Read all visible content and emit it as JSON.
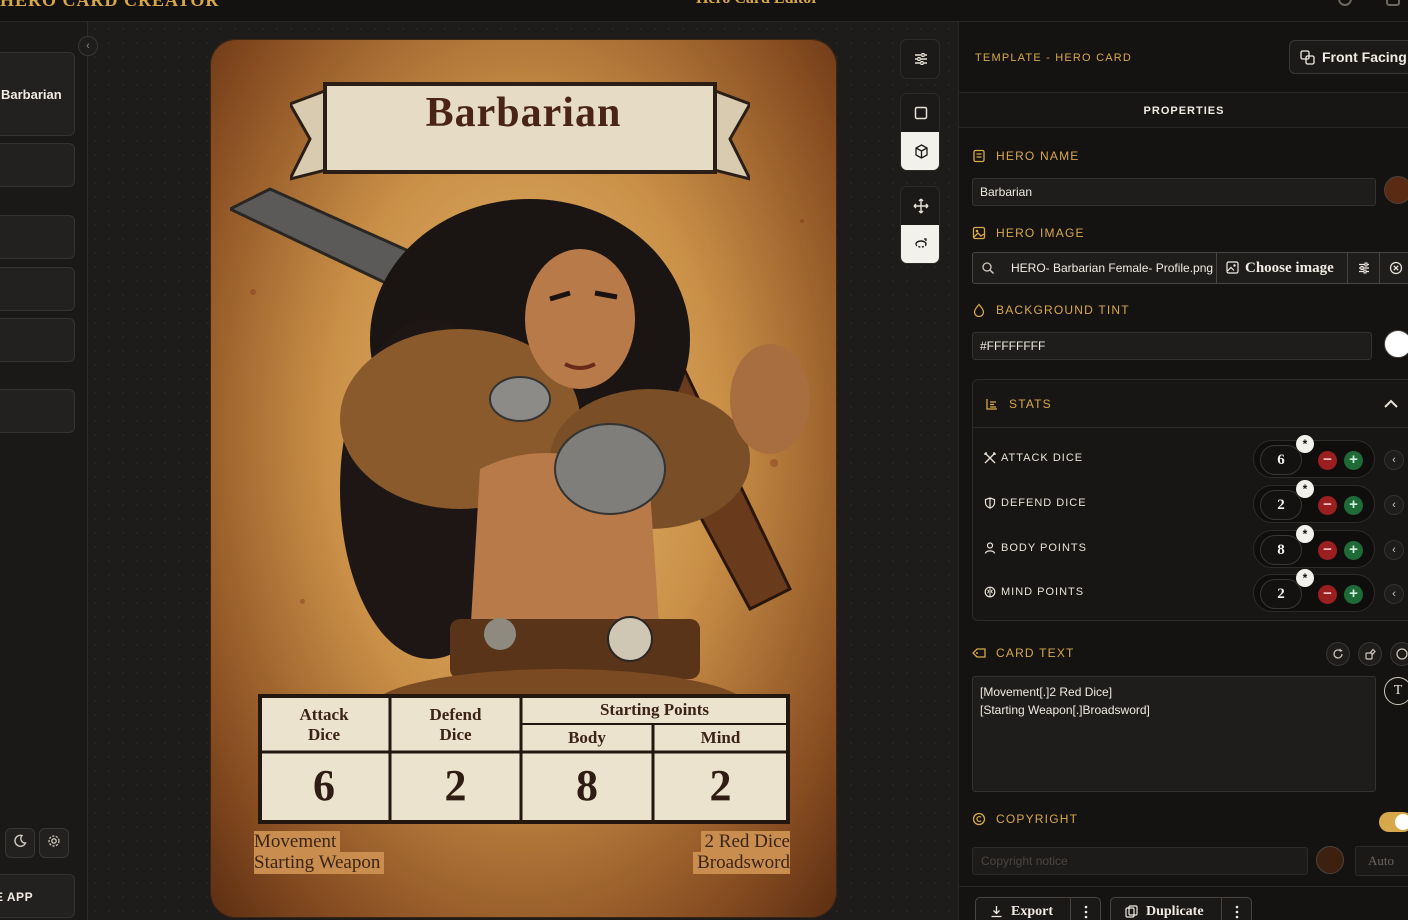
{
  "topbar": {
    "brand": "HERO CARD CREATOR",
    "card_title": "Hero Card Editor"
  },
  "sidebar": {
    "items": [
      {
        "label": "Barbarian"
      },
      {
        "label": ""
      },
      {
        "label": ""
      },
      {
        "label": ""
      },
      {
        "label": ""
      },
      {
        "label": ""
      }
    ],
    "app_button": "E APP"
  },
  "card": {
    "title": "Barbarian",
    "stat_labels": {
      "attack": "Attack\nDice",
      "defend": "Defend\nDice",
      "starting": "Starting Points",
      "body": "Body",
      "mind": "Mind"
    },
    "stat_values": {
      "attack": "6",
      "defend": "2",
      "body": "8",
      "mind": "2"
    },
    "lines": [
      {
        "key": "Movement",
        "value": "2 Red Dice"
      },
      {
        "key": "Starting Weapon",
        "value": "Broadsword"
      }
    ]
  },
  "panel": {
    "template_label": "TEMPLATE - HERO CARD",
    "front_label": "Front Facing",
    "properties_label": "PROPERTIES",
    "hero_name": {
      "label": "HERO NAME",
      "value": "Barbarian",
      "swatch": "#5a2a12"
    },
    "hero_image": {
      "label": "HERO IMAGE",
      "filename": "HERO- Barbarian Female- Profile.png",
      "choose_label": "Choose image"
    },
    "background_tint": {
      "label": "BACKGROUND TINT",
      "value": "#FFFFFFFF",
      "swatch": "#ffffff"
    },
    "stats": {
      "label": "STATS",
      "rows": [
        {
          "name": "ATTACK DICE",
          "value": "6",
          "icon": "crossed-swords-icon"
        },
        {
          "name": "DEFEND DICE",
          "value": "2",
          "icon": "shield-icon"
        },
        {
          "name": "BODY POINTS",
          "value": "8",
          "icon": "person-icon"
        },
        {
          "name": "MIND POINTS",
          "value": "2",
          "icon": "brain-icon"
        }
      ]
    },
    "card_text": {
      "label": "CARD TEXT",
      "value": "[Movement[.]2 Red Dice]\n[Starting Weapon[.]Broadsword]"
    },
    "copyright": {
      "label": "COPYRIGHT",
      "placeholder": "Copyright notice",
      "auto_label": "Auto",
      "swatch": "#3e200e"
    },
    "actions": {
      "export_label": "Export",
      "duplicate_label": "Duplicate"
    }
  },
  "colors": {
    "accent": "#d7a84a",
    "minus": "#9c1f1f",
    "plus": "#1f6b37"
  }
}
